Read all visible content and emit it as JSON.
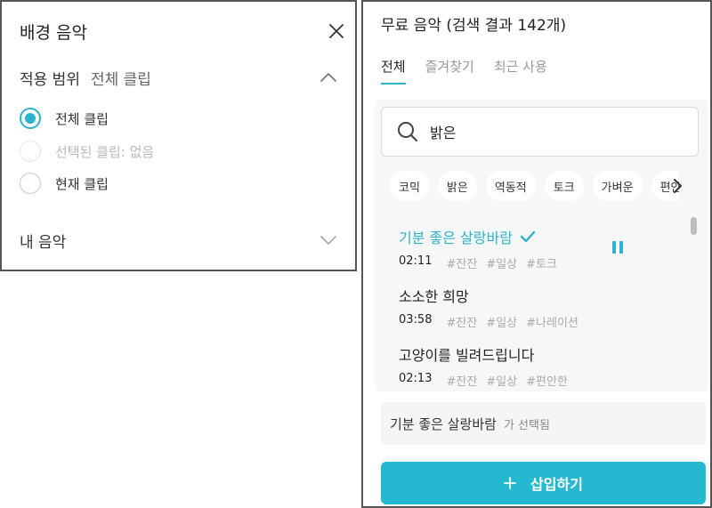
{
  "background_music_panel": {
    "title": "배경 음악",
    "scope": {
      "label": "적용 범위",
      "value": "전체 클립"
    },
    "options": [
      {
        "label": "전체 클립",
        "state": "checked"
      },
      {
        "label": "선택된 클립: 없음",
        "state": "disabled"
      },
      {
        "label": "현재 클립",
        "state": "unchecked"
      }
    ],
    "my_music_label": "내 음악"
  },
  "free_music_panel": {
    "title": "무료 음악 (검색 결과 142개)",
    "tabs": [
      {
        "label": "전체",
        "active": true
      },
      {
        "label": "즐겨찾기",
        "active": false
      },
      {
        "label": "최근 사용",
        "active": false
      }
    ],
    "search": {
      "value": "밝은"
    },
    "chips": [
      "코믹",
      "밝은",
      "역동적",
      "토크",
      "가벼운",
      "편안한"
    ],
    "tracks": [
      {
        "title": "기분 좋은 살랑바람",
        "duration": "02:11",
        "tags": [
          "#잔잔",
          "#일상",
          "#토크"
        ],
        "selected": true
      },
      {
        "title": "소소한 희망",
        "duration": "03:58",
        "tags": [
          "#잔잔",
          "#일상",
          "#나레이션"
        ],
        "selected": false
      },
      {
        "title": "고양이를 빌려드립니다",
        "duration": "02:13",
        "tags": [
          "#잔잔",
          "#일상",
          "#편안한"
        ],
        "selected": false
      }
    ],
    "selection": {
      "title": "기분 좋은 살랑바람",
      "suffix": "가 선택됨"
    },
    "insert_label": "삽입하기"
  },
  "colors": {
    "accent": "#2bb3cd",
    "button": "#25b9d1"
  },
  "icons": {
    "close": "close-icon",
    "chevron_up": "chevron-up-icon",
    "chevron_down": "chevron-down-icon",
    "search": "search-icon",
    "check": "check-icon",
    "pause": "pause-icon",
    "plus": "plus-icon",
    "chevron_right": "chevron-right-icon"
  }
}
